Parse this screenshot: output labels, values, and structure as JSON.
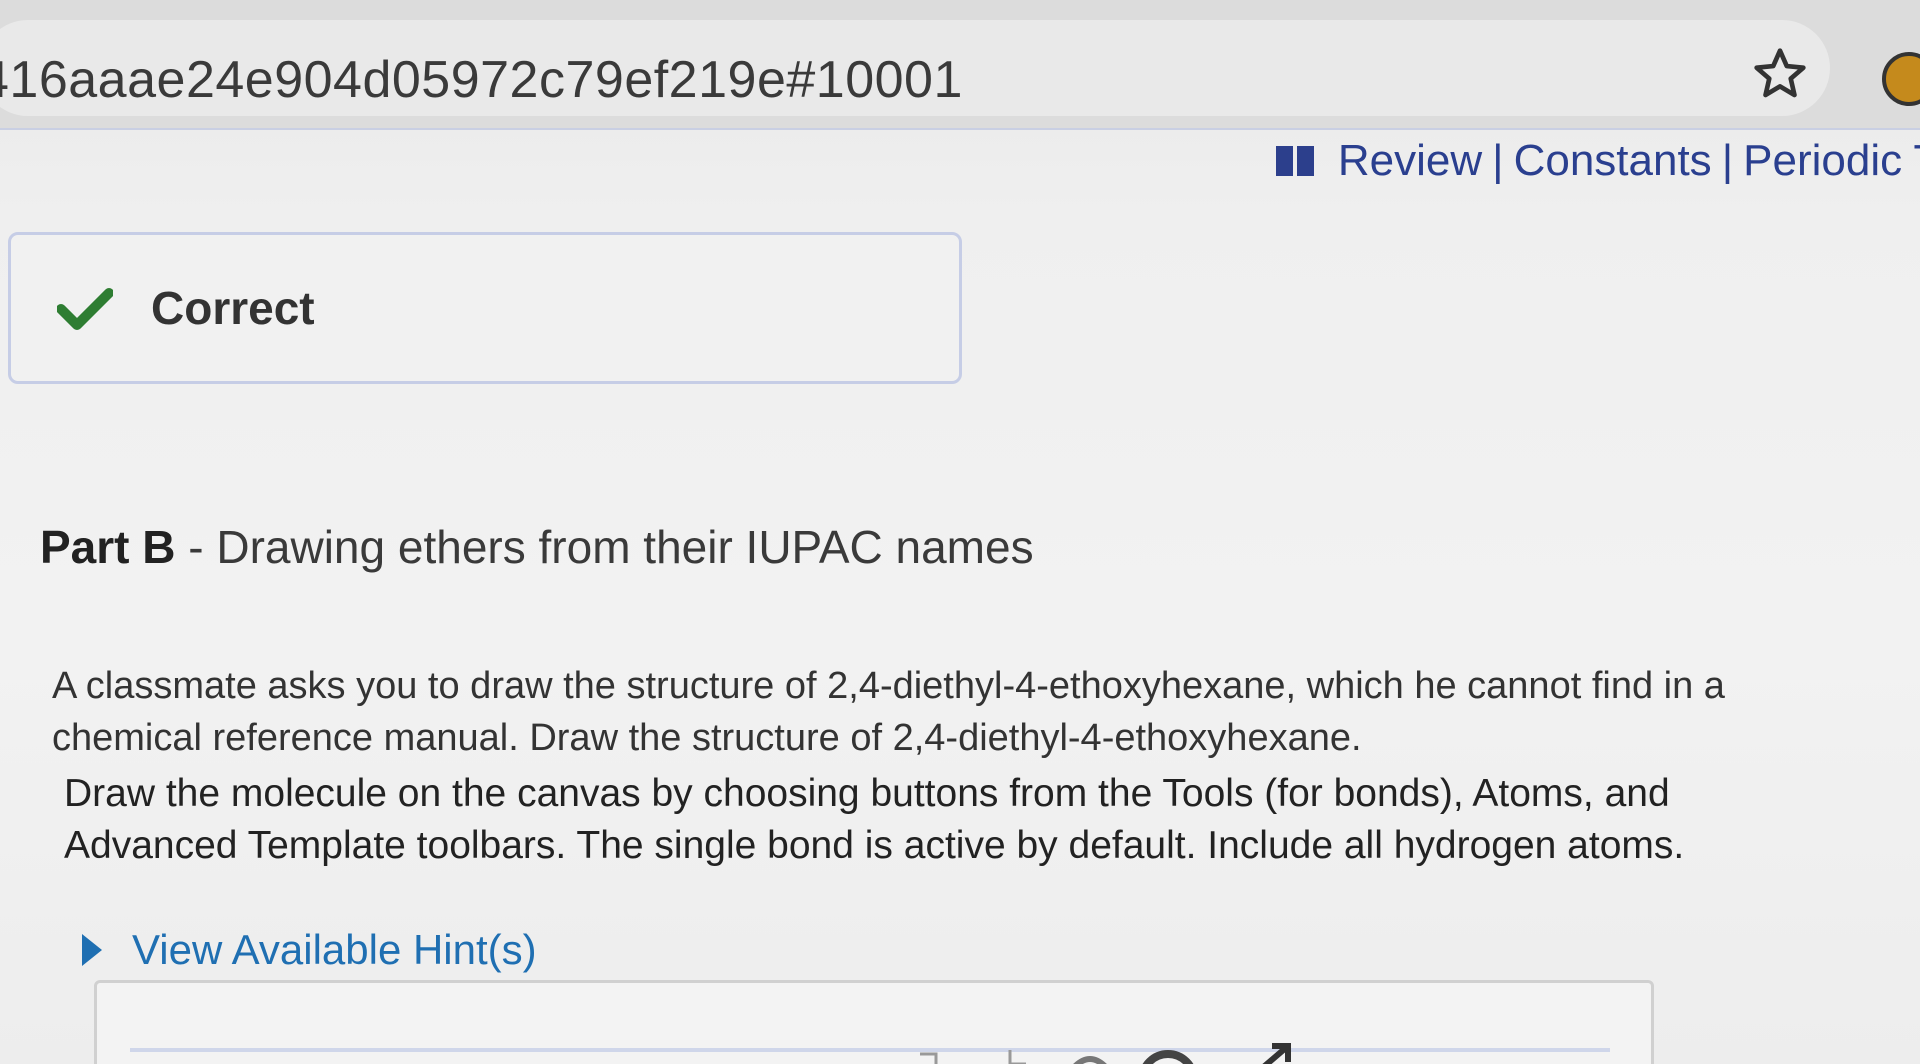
{
  "browser": {
    "url": "416aaae24e904d05972c79ef219e#10001"
  },
  "top_links": {
    "review": "Review",
    "separator": "|",
    "constants": "Constants",
    "periodic": "Periodic Ta"
  },
  "feedback": {
    "status": "Correct"
  },
  "part": {
    "label": "Part B",
    "dash": " - ",
    "title": "Drawing ethers from their IUPAC names"
  },
  "question": {
    "paragraph1": "A classmate asks you to draw the structure of 2,4-diethyl-4-ethoxyhexane, which he cannot find in a chemical reference manual. Draw the structure of 2,4-diethyl-4-ethoxyhexane.",
    "paragraph2": "Draw the molecule on the canvas by choosing buttons from the Tools (for bonds), Atoms, and Advanced Template toolbars. The single bond is active by default. Include all hydrogen atoms."
  },
  "hint": {
    "label": "View Available Hint(s)"
  },
  "colors": {
    "accent_link": "#2a3f8f",
    "hint_blue": "#1f6fb2",
    "check_green": "#2e7d32"
  }
}
